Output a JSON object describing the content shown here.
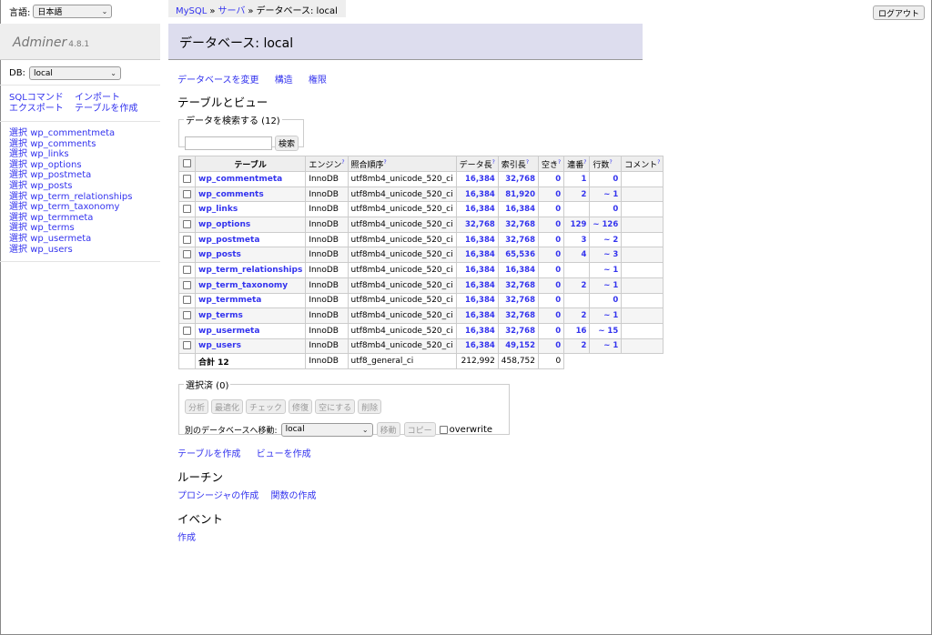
{
  "language": {
    "label": "言語:",
    "selected": "日本語"
  },
  "logo": {
    "name": "Adminer",
    "version": "4.8.1"
  },
  "db": {
    "label": "DB:",
    "selected": "local"
  },
  "menu_links": [
    "SQLコマンド",
    "インポート",
    "エクスポート",
    "テーブルを作成"
  ],
  "menu_tables": [
    {
      "select": "選択",
      "name": "wp_commentmeta"
    },
    {
      "select": "選択",
      "name": "wp_comments"
    },
    {
      "select": "選択",
      "name": "wp_links"
    },
    {
      "select": "選択",
      "name": "wp_options"
    },
    {
      "select": "選択",
      "name": "wp_postmeta"
    },
    {
      "select": "選択",
      "name": "wp_posts"
    },
    {
      "select": "選択",
      "name": "wp_term_relationships"
    },
    {
      "select": "選択",
      "name": "wp_term_taxonomy"
    },
    {
      "select": "選択",
      "name": "wp_termmeta"
    },
    {
      "select": "選択",
      "name": "wp_terms"
    },
    {
      "select": "選択",
      "name": "wp_usermeta"
    },
    {
      "select": "選択",
      "name": "wp_users"
    }
  ],
  "breadcrumb": {
    "items": [
      "MySQL",
      "サーバ"
    ],
    "sep": "»",
    "current": "データベース: local"
  },
  "logout": "ログアウト",
  "page_title": "データベース: local",
  "subnav": [
    "データベースを変更",
    "構造",
    "権限"
  ],
  "tables_heading": "テーブルとビュー",
  "search": {
    "legend": "データを検索する (12)",
    "value": "",
    "button": "検索"
  },
  "table": {
    "headers": {
      "table": "テーブル",
      "engine": "エンジン",
      "collation": "照合順序",
      "data_length": "データ長",
      "index_length": "索引長",
      "free": "空き",
      "auto_increment": "連番",
      "rows": "行数",
      "comment": "コメント",
      "help": "?"
    },
    "rows": [
      {
        "name": "wp_commentmeta",
        "engine": "InnoDB",
        "collation": "utf8mb4_unicode_520_ci",
        "data": "16,384",
        "index": "32,768",
        "free": "0",
        "ai": "1",
        "rows": "0",
        "comment": ""
      },
      {
        "name": "wp_comments",
        "engine": "InnoDB",
        "collation": "utf8mb4_unicode_520_ci",
        "data": "16,384",
        "index": "81,920",
        "free": "0",
        "ai": "2",
        "rows": "~ 1",
        "comment": ""
      },
      {
        "name": "wp_links",
        "engine": "InnoDB",
        "collation": "utf8mb4_unicode_520_ci",
        "data": "16,384",
        "index": "16,384",
        "free": "0",
        "ai": "",
        "rows": "0",
        "comment": ""
      },
      {
        "name": "wp_options",
        "engine": "InnoDB",
        "collation": "utf8mb4_unicode_520_ci",
        "data": "32,768",
        "index": "32,768",
        "free": "0",
        "ai": "129",
        "rows": "~ 126",
        "comment": ""
      },
      {
        "name": "wp_postmeta",
        "engine": "InnoDB",
        "collation": "utf8mb4_unicode_520_ci",
        "data": "16,384",
        "index": "32,768",
        "free": "0",
        "ai": "3",
        "rows": "~ 2",
        "comment": ""
      },
      {
        "name": "wp_posts",
        "engine": "InnoDB",
        "collation": "utf8mb4_unicode_520_ci",
        "data": "16,384",
        "index": "65,536",
        "free": "0",
        "ai": "4",
        "rows": "~ 3",
        "comment": ""
      },
      {
        "name": "wp_term_relationships",
        "engine": "InnoDB",
        "collation": "utf8mb4_unicode_520_ci",
        "data": "16,384",
        "index": "16,384",
        "free": "0",
        "ai": "",
        "rows": "~ 1",
        "comment": ""
      },
      {
        "name": "wp_term_taxonomy",
        "engine": "InnoDB",
        "collation": "utf8mb4_unicode_520_ci",
        "data": "16,384",
        "index": "32,768",
        "free": "0",
        "ai": "2",
        "rows": "~ 1",
        "comment": ""
      },
      {
        "name": "wp_termmeta",
        "engine": "InnoDB",
        "collation": "utf8mb4_unicode_520_ci",
        "data": "16,384",
        "index": "32,768",
        "free": "0",
        "ai": "",
        "rows": "0",
        "comment": ""
      },
      {
        "name": "wp_terms",
        "engine": "InnoDB",
        "collation": "utf8mb4_unicode_520_ci",
        "data": "16,384",
        "index": "32,768",
        "free": "0",
        "ai": "2",
        "rows": "~ 1",
        "comment": ""
      },
      {
        "name": "wp_usermeta",
        "engine": "InnoDB",
        "collation": "utf8mb4_unicode_520_ci",
        "data": "16,384",
        "index": "32,768",
        "free": "0",
        "ai": "16",
        "rows": "~ 15",
        "comment": ""
      },
      {
        "name": "wp_users",
        "engine": "InnoDB",
        "collation": "utf8mb4_unicode_520_ci",
        "data": "16,384",
        "index": "49,152",
        "free": "0",
        "ai": "2",
        "rows": "~ 1",
        "comment": ""
      }
    ],
    "total": {
      "label": "合計 12",
      "engine": "InnoDB",
      "collation": "utf8_general_ci",
      "data": "212,992",
      "index": "458,752",
      "free": "0"
    }
  },
  "selected": {
    "legend": "選択済 (0)",
    "buttons": [
      "分析",
      "最適化",
      "チェック",
      "修復",
      "空にする",
      "削除"
    ],
    "move_label": "別のデータベースへ移動:",
    "move_target": "local",
    "move_button": "移動",
    "copy_button": "コピー",
    "overwrite": "overwrite"
  },
  "create_links": [
    "テーブルを作成",
    "ビューを作成"
  ],
  "routines_heading": "ルーチン",
  "routine_links": [
    "プロシージャの作成",
    "関数の作成"
  ],
  "events_heading": "イベント",
  "event_links": [
    "作成"
  ],
  "colors": {
    "link": "#3333ee",
    "title_bg": "#ddddee",
    "header_bg": "#eeeeee"
  }
}
